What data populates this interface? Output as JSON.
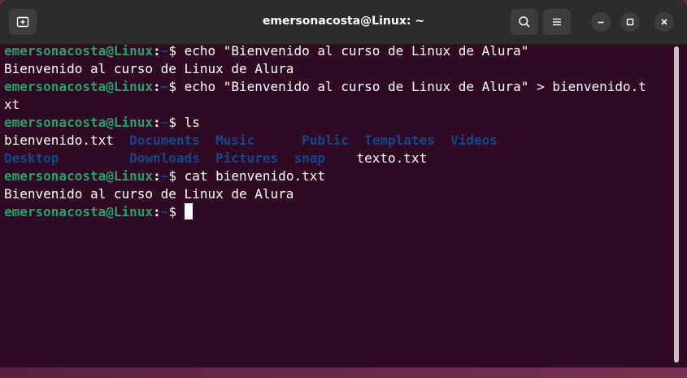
{
  "window": {
    "title": "emersonacosta@Linux: ~"
  },
  "titlebar": {
    "icons": [
      "new-tab-icon",
      "search-icon",
      "hamburger-menu-icon",
      "minimize-icon",
      "maximize-icon",
      "close-icon"
    ]
  },
  "prompt": {
    "user_host": "emersonacosta@Linux",
    "colon": ":",
    "path": "~",
    "symbol": "$"
  },
  "terminal": {
    "cmd1": " echo \"Bienvenido al curso de Linux de Alura\"",
    "out1": "Bienvenido al curso de Linux de Alura",
    "cmd2": " echo \"Bienvenido al curso de Linux de Alura\" > bienvenido.t",
    "cmd2_wrap": "xt",
    "cmd3": " ls",
    "ls_row1": [
      "bienvenido.txt",
      "Documents",
      "Music",
      "Public",
      "Templates",
      "Videos"
    ],
    "ls_row2": [
      "Desktop",
      "Downloads",
      "Pictures",
      "snap",
      "texto.txt"
    ],
    "cmd4": " cat bienvenido.txt",
    "out4": "Bienvenido al curso de Linux de Alura",
    "cmd5": " "
  },
  "colors": {
    "background": "#300a24",
    "titlebar": "#2c2c2c",
    "user": "#26a269",
    "directory": "#12488b",
    "text": "#ffffff"
  }
}
